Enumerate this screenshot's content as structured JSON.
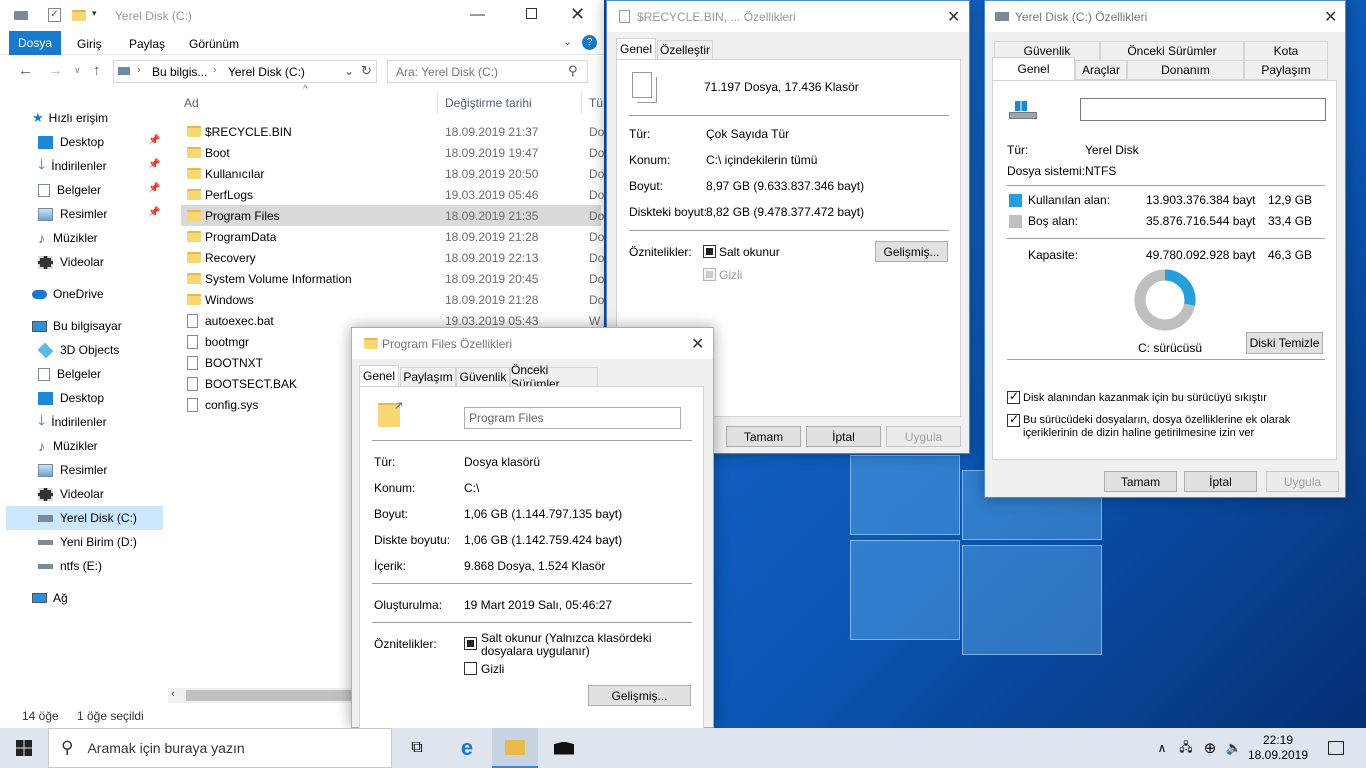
{
  "explorer": {
    "ribbon": {
      "file": "Dosya",
      "home": "Giriş",
      "share": "Paylaş",
      "view": "Görünüm"
    },
    "address": {
      "part1": "Bu bilgis...",
      "part2": "Yerel Disk (C:)"
    },
    "search_placeholder": "Ara: Yerel Disk (C:)",
    "columns": {
      "name": "Ad",
      "date": "Değiştirme tarihi",
      "type": "Tü"
    },
    "nav": {
      "quick": "Hızlı erişim",
      "desktop": "Desktop",
      "downloads": "İndirilenler",
      "docs": "Belgeler",
      "pics": "Resimler",
      "music": "Müzikler",
      "videos": "Videolar",
      "onedrive": "OneDrive",
      "thispc": "Bu bilgisayar",
      "obj3d": "3D Objects",
      "docs2": "Belgeler",
      "desktop2": "Desktop",
      "downloads2": "İndirilenler",
      "music2": "Müzikler",
      "pics2": "Resimler",
      "videos2": "Videolar",
      "c": "Yerel Disk (C:)",
      "d": "Yeni Birim (D:)",
      "e": "ntfs (E:)",
      "net": "Ağ"
    },
    "files": [
      {
        "name": "$RECYCLE.BIN",
        "date": "18.09.2019 21:37",
        "type": "Do"
      },
      {
        "name": "Boot",
        "date": "18.09.2019 19:47",
        "type": "Do"
      },
      {
        "name": "Kullanıcılar",
        "date": "18.09.2019 20:50",
        "type": "Do"
      },
      {
        "name": "PerfLogs",
        "date": "19.03.2019 05:46",
        "type": "Do"
      },
      {
        "name": "Program Files",
        "date": "18.09.2019 21:35",
        "type": "Do"
      },
      {
        "name": "ProgramData",
        "date": "18.09.2019 21:28",
        "type": "Do"
      },
      {
        "name": "Recovery",
        "date": "18.09.2019 22:13",
        "type": "Do"
      },
      {
        "name": "System Volume Information",
        "date": "18.09.2019 20:45",
        "type": "Do"
      },
      {
        "name": "Windows",
        "date": "18.09.2019 21:28",
        "type": "Do"
      },
      {
        "name": "autoexec.bat",
        "date": "19.03.2019 05:43",
        "type": "W"
      },
      {
        "name": "bootmgr",
        "date": "",
        "type": ""
      },
      {
        "name": "BOOTNXT",
        "date": "",
        "type": ""
      },
      {
        "name": "BOOTSECT.BAK",
        "date": "",
        "type": ""
      },
      {
        "name": "config.sys",
        "date": "",
        "type": ""
      }
    ],
    "status": {
      "count": "14 öğe",
      "selected": "1 öğe seçildi"
    }
  },
  "recycle": {
    "title": "$RECYCLE.BIN, ... Özellikleri",
    "tabs": [
      "Genel",
      "Özelleştir"
    ],
    "summary": "71.197 Dosya, 17.436 Klasör",
    "rows": [
      {
        "label": "Tür:",
        "value": "Çok Sayıda Tür"
      },
      {
        "label": "Konum:",
        "value": "C:\\ içindekilerin tümü"
      },
      {
        "label": "Boyut:",
        "value": "8,97 GB (9.633.837.346 bayt)"
      },
      {
        "label": "Diskteki boyut:",
        "value": "8,82 GB (9.478.377.472 bayt)"
      }
    ],
    "attr_label": "Öznitelikler:",
    "readonly": "Salt okunur",
    "hidden": "Gizli",
    "advanced": "Gelişmiş...",
    "ok": "Tamam",
    "cancel": "İptal",
    "apply": "Uygula"
  },
  "progfiles": {
    "title": "Program Files Özellikleri",
    "tabs": [
      "Genel",
      "Paylaşım",
      "Güvenlik",
      "Önceki Sürümler"
    ],
    "name": "Program Files",
    "rows": [
      {
        "label": "Tür:",
        "value": "Dosya klasörü"
      },
      {
        "label": "Konum:",
        "value": "C:\\"
      },
      {
        "label": "Boyut:",
        "value": "1,06 GB (1.144.797.135 bayt)"
      },
      {
        "label": "Diskte boyutu:",
        "value": "1,06 GB (1.142.759.424 bayt)"
      },
      {
        "label": "İçerik:",
        "value": "9.868 Dosya, 1.524 Klasör"
      }
    ],
    "created_label": "Oluşturulma:",
    "created": "19 Mart 2019 Salı, 05:46:27",
    "attr_label": "Öznitelikler:",
    "readonly": "Salt okunur (Yalnızca klasördeki dosyalara uygulanır)",
    "hidden": "Gizli",
    "advanced": "Gelişmiş..."
  },
  "disk": {
    "title": "Yerel Disk (C:) Özellikleri",
    "tabs_top": [
      "Güvenlik",
      "Önceki Sürümler",
      "Kota"
    ],
    "tabs_bottom": [
      "Genel",
      "Araçlar",
      "Donanım",
      "Paylaşım"
    ],
    "type_label": "Tür:",
    "type": "Yerel Disk",
    "fs_label": "Dosya sistemi:",
    "fs": "NTFS",
    "used_label": "Kullanılan alan:",
    "used_bytes": "13.903.376.384 bayt",
    "used_gb": "12,9 GB",
    "free_label": "Boş alan:",
    "free_bytes": "35.876.716.544 bayt",
    "free_gb": "33,4 GB",
    "cap_label": "Kapasite:",
    "cap_bytes": "49.780.092.928 bayt",
    "cap_gb": "46,3 GB",
    "used_fraction": 0.279,
    "used_color": "#26a0da",
    "free_color": "#bfbfbf",
    "drive": "C: sürücüsü",
    "cleanup": "Diski Temizle",
    "compress": "Disk alanından kazanmak için bu sürücüyü sıkıştır",
    "index": "Bu sürücüdeki dosyaların, dosya özelliklerine ek olarak içeriklerinin de dizin haline getirilmesine izin ver",
    "ok": "Tamam",
    "cancel": "İptal",
    "apply": "Uygula"
  },
  "taskbar": {
    "search": "Aramak için buraya yazın",
    "time": "22:19",
    "date": "18.09.2019"
  }
}
